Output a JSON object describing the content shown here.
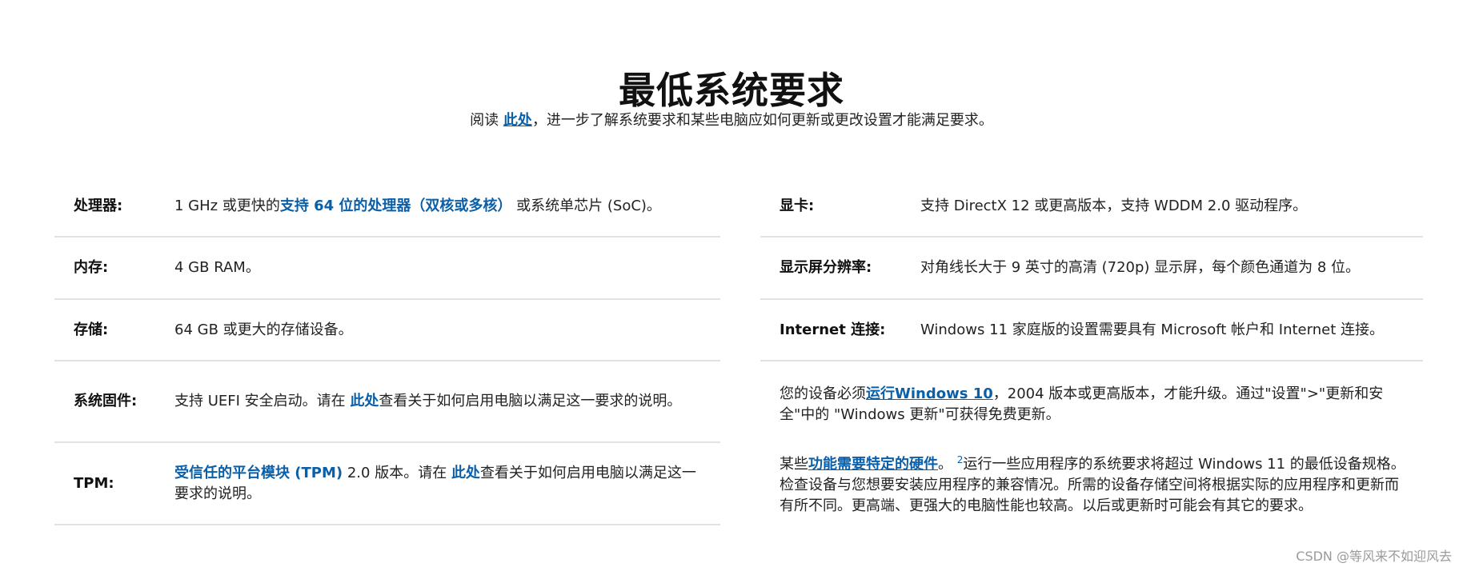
{
  "title": "最低系统要求",
  "intro": {
    "prefix": "阅读",
    "link": "此处",
    "suffix": "，进一步了解系统要求和某些电脑应如何更新或更改设置才能满足要求。"
  },
  "left": {
    "processor": {
      "label": "处理器:",
      "text1": "1 GHz 或更快的",
      "link": "支持 64 位的处理器（双核或多核）",
      "text2": "或系统单芯片 (SoC)。"
    },
    "memory": {
      "label": "内存:",
      "value": "4 GB RAM。"
    },
    "storage": {
      "label": "存储:",
      "value": "64 GB 或更大的存储设备。"
    },
    "firmware": {
      "label": "系统固件:",
      "text1": "支持 UEFI 安全启动。请在",
      "link": "此处",
      "text2": "查看关于如何启用电脑以满足这一要求的说明。"
    },
    "tpm": {
      "label": "TPM:",
      "link": "受信任的平台模块 (TPM)",
      "text1": "2.0 版本。请在",
      "link2": "此处",
      "text2": "查看关于如何启用电脑以满足这一要求的说明。"
    }
  },
  "right": {
    "graphics": {
      "label": "显卡:",
      "value": "支持 DirectX 12 或更高版本，支持 WDDM 2.0 驱动程序。"
    },
    "display": {
      "label": "显示屏分辨率:",
      "value": "对角线长大于 9 英寸的高清 (720p) 显示屏，每个颜色通道为 8 位。"
    },
    "internet": {
      "label": "Internet 连接:",
      "value": "Windows 11 家庭版的设置需要具有 Microsoft 帐户和 Internet 连接。"
    },
    "note1": {
      "text1": "您的设备必须",
      "link": "运行Windows 10",
      "text2": "，2004 版本或更高版本，才能升级。通过\"设置\">\"更新和安全\"中的 \"Windows 更新\"可获得免费更新。"
    },
    "note2": {
      "text1": "某些",
      "link": "功能需要特定的硬件",
      "text2": "。",
      "sup": "2",
      "text3": "运行一些应用程序的系统要求将超过 Windows 11 的最低设备规格。检查设备与您想要安装应用程序的兼容情况。所需的设备存储空间将根据实际的应用程序和更新而有所不同。更高端、更强大的电脑性能也较高。以后或更新时可能会有其它的要求。"
    }
  },
  "watermark": "CSDN @等风来不如迎风去"
}
